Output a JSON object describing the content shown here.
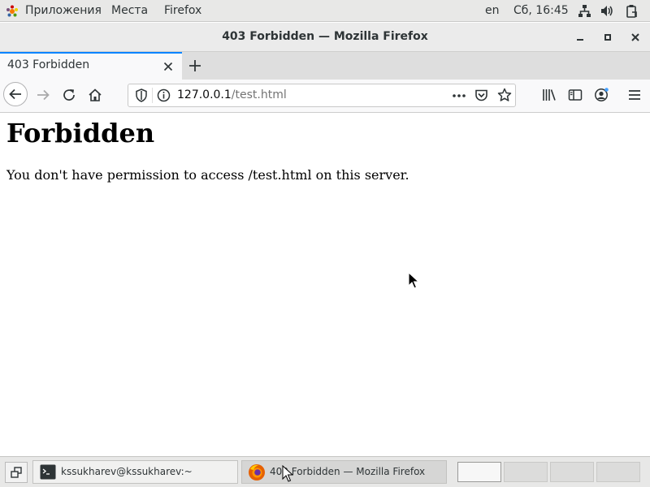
{
  "topbar": {
    "apps_label": "Приложения",
    "places_label": "Места",
    "active_app_label": "Firefox",
    "language": "en",
    "clock": "Сб, 16:45",
    "icons": [
      "network-icon",
      "volume-icon",
      "clipboard-icon"
    ]
  },
  "window": {
    "title": "403 Forbidden — Mozilla Firefox"
  },
  "tabs": [
    {
      "title": "403 Forbidden",
      "active": true
    }
  ],
  "navbar": {
    "url_host": "127.0.0.1",
    "url_path": "/test.html"
  },
  "page": {
    "heading": "Forbidden",
    "message": "You don't have permission to access /test.html on this server."
  },
  "taskbar": {
    "tasks": [
      {
        "label": "kssukharev@kssukharev:~",
        "icon": "terminal-icon",
        "active": false
      },
      {
        "label": "403 Forbidden — Mozilla Firefox",
        "icon": "firefox-icon",
        "active": true
      }
    ],
    "workspaces": 4,
    "current_workspace": 1
  },
  "colors": {
    "tab_accent": "#0a84ff",
    "panel_bg": "#e8e8e7"
  }
}
